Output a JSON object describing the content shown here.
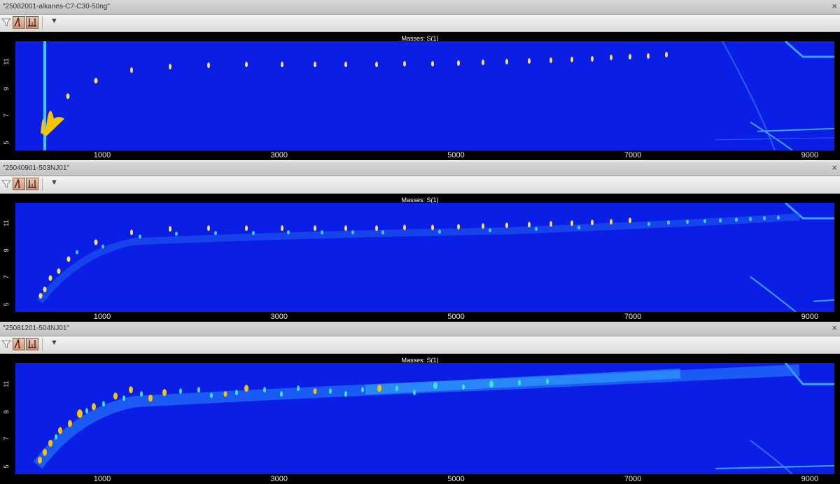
{
  "panels": [
    {
      "title": "\"25082001-alkanes-C7-C30-50ng\"",
      "close_label": "×",
      "plot_label": "Masses: S(1)",
      "more_label": "▼",
      "y_ticks": [
        "5",
        "7",
        "9",
        "11"
      ],
      "x_ticks": [
        "1000",
        "3000",
        "5000",
        "7000",
        "9000"
      ]
    },
    {
      "title": "\"25040901-503NJ01\"",
      "close_label": "×",
      "plot_label": "Masses: S(1)",
      "more_label": "▼",
      "y_ticks": [
        "5",
        "7",
        "9",
        "11"
      ],
      "x_ticks": [
        "1000",
        "3000",
        "5000",
        "7000",
        "9000"
      ]
    },
    {
      "title": "\"25081201-504NJ01\"",
      "close_label": "×",
      "plot_label": "Masses: S(1)",
      "more_label": "▼",
      "y_ticks": [
        "5",
        "7",
        "9",
        "11"
      ],
      "x_ticks": [
        "1000",
        "3000",
        "5000",
        "7000",
        "9000"
      ]
    }
  ],
  "icons": {
    "filter": "funnel-icon",
    "peak": "peak-icon",
    "baseline": "baseline-icon",
    "more": "dropdown-arrow-icon"
  },
  "colors": {
    "plot_background": "#0a1ee6",
    "peak_low": "#40c8ff",
    "peak_high": "#f5c400"
  }
}
